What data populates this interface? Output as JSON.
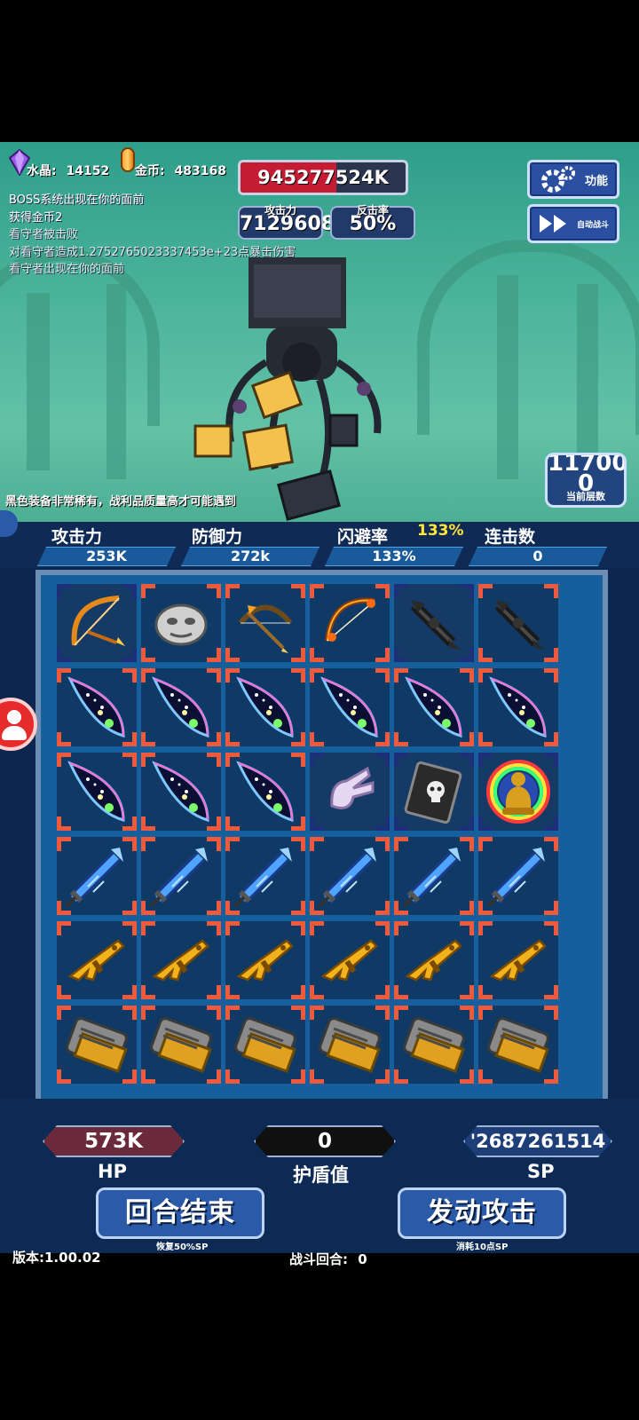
{
  "header": {
    "crystal_label": "水晶:",
    "crystal_value": "14152",
    "gold_label": "金币:",
    "gold_value": "483168",
    "boss_hp": "945277524K",
    "boss_hp_fraction": 0.58,
    "attack_label": "攻击力",
    "attack_value": "7129608",
    "counter_label": "反击率",
    "counter_value": "50%",
    "function_button": "功能",
    "auto_battle_button": "自动战斗",
    "floor_number_top": "11700",
    "floor_number": "0",
    "floor_caption": "当前层数"
  },
  "battle_log": [
    "BOSS系统出现在你的面前",
    "获得金币2",
    "看守者被击败",
    "对看守者造成1.2752765023337453e+23点暴击伤害",
    "看守者出现在你的面前"
  ],
  "rare_message": "黑色装备非常稀有，战利品质量高才可能遇到",
  "stats": {
    "attack_label": "攻击力",
    "attack_value": "253K",
    "defense_label": "防御力",
    "defense_value": "272k",
    "dodge_label": "闪避率",
    "dodge_value": "133%",
    "dodge_bonus": "133%",
    "combo_label": "连击数",
    "combo_value": "0"
  },
  "board": {
    "rows": [
      [
        "golden-bow-icon",
        "stone-mask-icon",
        "wooden-bow-icon",
        "flame-bow-icon",
        "dark-claw-icon",
        "dark-claw-icon"
      ],
      [
        "cosmic-feather-icon",
        "cosmic-feather-icon",
        "cosmic-feather-icon",
        "cosmic-feather-icon",
        "cosmic-feather-icon",
        "cosmic-feather-icon"
      ],
      [
        "cosmic-feather-icon",
        "cosmic-feather-icon",
        "cosmic-feather-icon",
        "pale-glove-icon",
        "skull-book-icon",
        "golden-buddha-icon"
      ],
      [
        "crystal-sword-icon",
        "crystal-sword-icon",
        "crystal-sword-icon",
        "crystal-sword-icon",
        "crystal-sword-icon",
        "crystal-sword-icon"
      ],
      [
        "gold-rifle-icon",
        "gold-rifle-icon",
        "gold-rifle-icon",
        "gold-rifle-icon",
        "gold-rifle-icon",
        "gold-rifle-icon"
      ],
      [
        "ammo-belt-icon",
        "ammo-belt-icon",
        "ammo-belt-icon",
        "ammo-belt-icon",
        "ammo-belt-icon",
        "ammo-belt-icon"
      ]
    ],
    "blue_frame_cells": [
      "0-0",
      "0-4",
      "2-3",
      "2-4",
      "2-5"
    ]
  },
  "bottom": {
    "hp_value": "573K",
    "hp_label": "HP",
    "shield_value": "0",
    "shield_label": "护盾值",
    "sp_value": "'2687261514",
    "sp_label": "SP",
    "end_turn_button": "回合结束",
    "end_turn_sub": "恢复50%SP",
    "attack_button": "发动攻击",
    "attack_sub": "消耗10点SP",
    "version": "版本:1.00.02",
    "battle_round_label": "战斗回合:",
    "battle_round_value": "0"
  },
  "colors": {
    "arena_bg": "#4fb59d",
    "hp_red": "#c51c34",
    "frame_orange": "#f05a3a",
    "panel_navy": "#0d2a54",
    "bonus_yellow": "#ffe83a"
  }
}
